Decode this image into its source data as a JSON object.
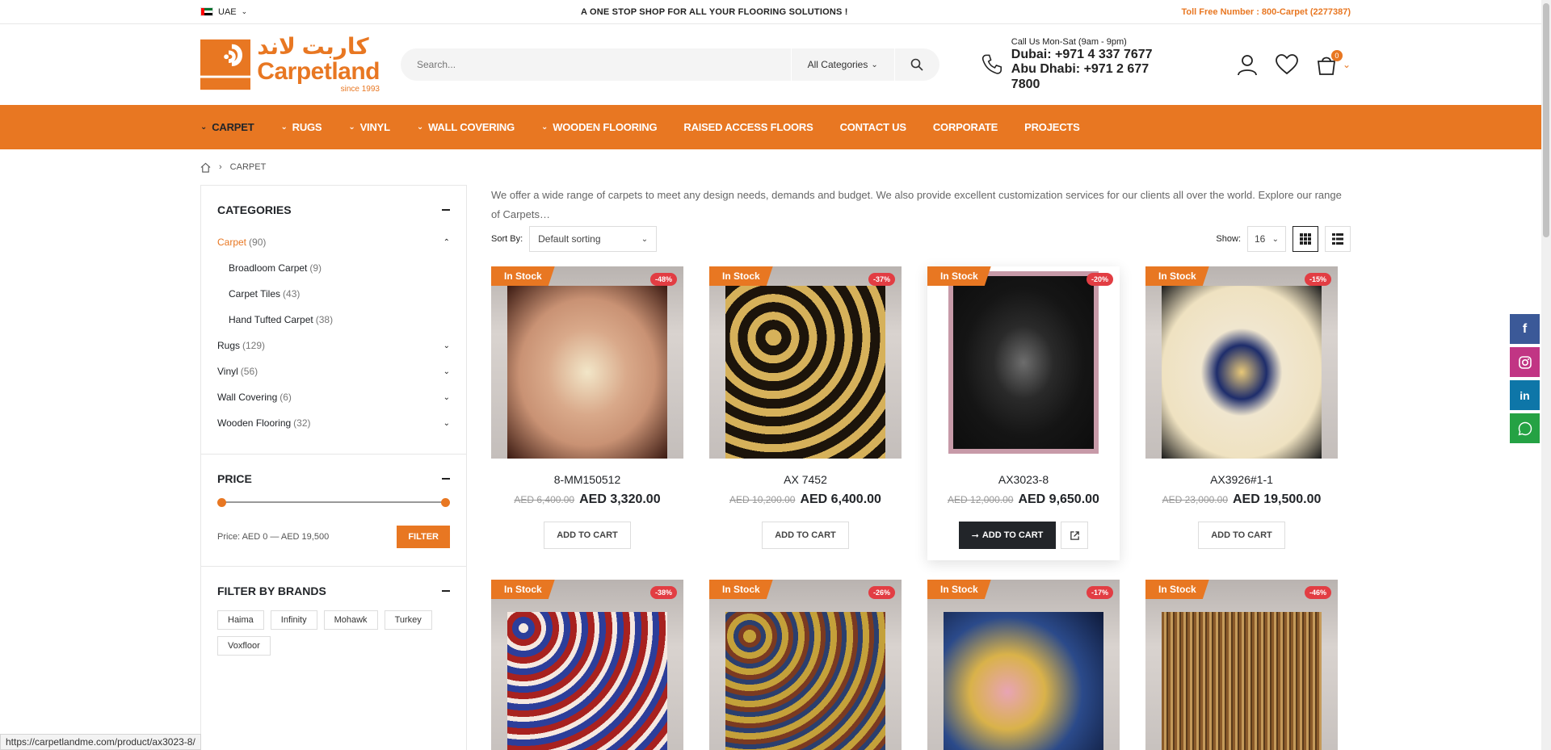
{
  "topbar": {
    "country": "UAE",
    "tagline": "A ONE STOP SHOP FOR ALL YOUR FLOORING SOLUTIONS !",
    "tollfree": "Toll Free Number : 800-Carpet (2277387)"
  },
  "header": {
    "logo_arabic": "كاربت لاند",
    "logo_name": "Carpetland",
    "logo_since": "since 1993",
    "search_placeholder": "Search...",
    "search_category": "All Categories",
    "call_hours": "Call Us Mon-Sat (9am - 9pm)",
    "dubai_phone": "Dubai: +971 4 337 7677",
    "abudhabi_phone": "Abu Dhabi: +971 2 677 7800",
    "cart_count": "0"
  },
  "nav": {
    "items": [
      {
        "label": "CARPET",
        "dropdown": true
      },
      {
        "label": "RUGS",
        "dropdown": true
      },
      {
        "label": "VINYL",
        "dropdown": true
      },
      {
        "label": "WALL COVERING",
        "dropdown": true
      },
      {
        "label": "WOODEN FLOORING",
        "dropdown": true
      },
      {
        "label": "RAISED ACCESS FLOORS",
        "dropdown": false
      },
      {
        "label": "CONTACT US",
        "dropdown": false
      },
      {
        "label": "CORPORATE",
        "dropdown": false
      },
      {
        "label": "PROJECTS",
        "dropdown": false
      }
    ]
  },
  "breadcrumb": {
    "current": "CARPET"
  },
  "sidebar": {
    "categories_title": "CATEGORIES",
    "categories": [
      {
        "name": "Carpet",
        "count": "(90)"
      },
      {
        "name": "Broadloom Carpet",
        "count": "(9)"
      },
      {
        "name": "Carpet Tiles",
        "count": "(43)"
      },
      {
        "name": "Hand Tufted Carpet",
        "count": "(38)"
      },
      {
        "name": "Rugs",
        "count": "(129)"
      },
      {
        "name": "Vinyl",
        "count": "(56)"
      },
      {
        "name": "Wall Covering",
        "count": "(6)"
      },
      {
        "name": "Wooden Flooring",
        "count": "(32)"
      }
    ],
    "price_title": "PRICE",
    "price_text": "Price: AED 0 — AED 19,500",
    "filter_label": "FILTER",
    "brands_title": "FILTER BY BRANDS",
    "brands": [
      "Haima",
      "Infinity",
      "Mohawk",
      "Turkey",
      "Voxfloor"
    ]
  },
  "content": {
    "intro": "We offer a wide range of carpets to meet any design needs, demands and budget. We also provide excellent customization services for our clients all over the world. Explore our range of Carpets…",
    "sort_label": "Sort By:",
    "sort_value": "Default sorting",
    "show_label": "Show:",
    "show_value": "16"
  },
  "products": [
    {
      "name": "8-MM150512",
      "old": "AED 6,400.00",
      "new": "AED 3,320.00",
      "sale": "-48%",
      "stock": "In Stock",
      "button": "ADD TO CART"
    },
    {
      "name": "AX 7452",
      "old": "AED 10,200.00",
      "new": "AED 6,400.00",
      "sale": "-37%",
      "stock": "In Stock",
      "button": "ADD TO CART"
    },
    {
      "name": "AX3023-8",
      "old": "AED 12,000.00",
      "new": "AED 9,650.00",
      "sale": "-20%",
      "stock": "In Stock",
      "button": "ADD TO CART"
    },
    {
      "name": "AX3926#1-1",
      "old": "AED 23,000.00",
      "new": "AED 19,500.00",
      "sale": "-15%",
      "stock": "In Stock",
      "button": "ADD TO CART"
    },
    {
      "sale": "-38%",
      "stock": "In Stock"
    },
    {
      "sale": "-26%",
      "stock": "In Stock"
    },
    {
      "sale": "-17%",
      "stock": "In Stock"
    },
    {
      "sale": "-46%",
      "stock": "In Stock"
    }
  ],
  "status_url": "https://carpetlandme.com/product/ax3023-8/",
  "colors": {
    "brand": "#e87722",
    "sale": "#e23d43",
    "dark": "#222529"
  }
}
